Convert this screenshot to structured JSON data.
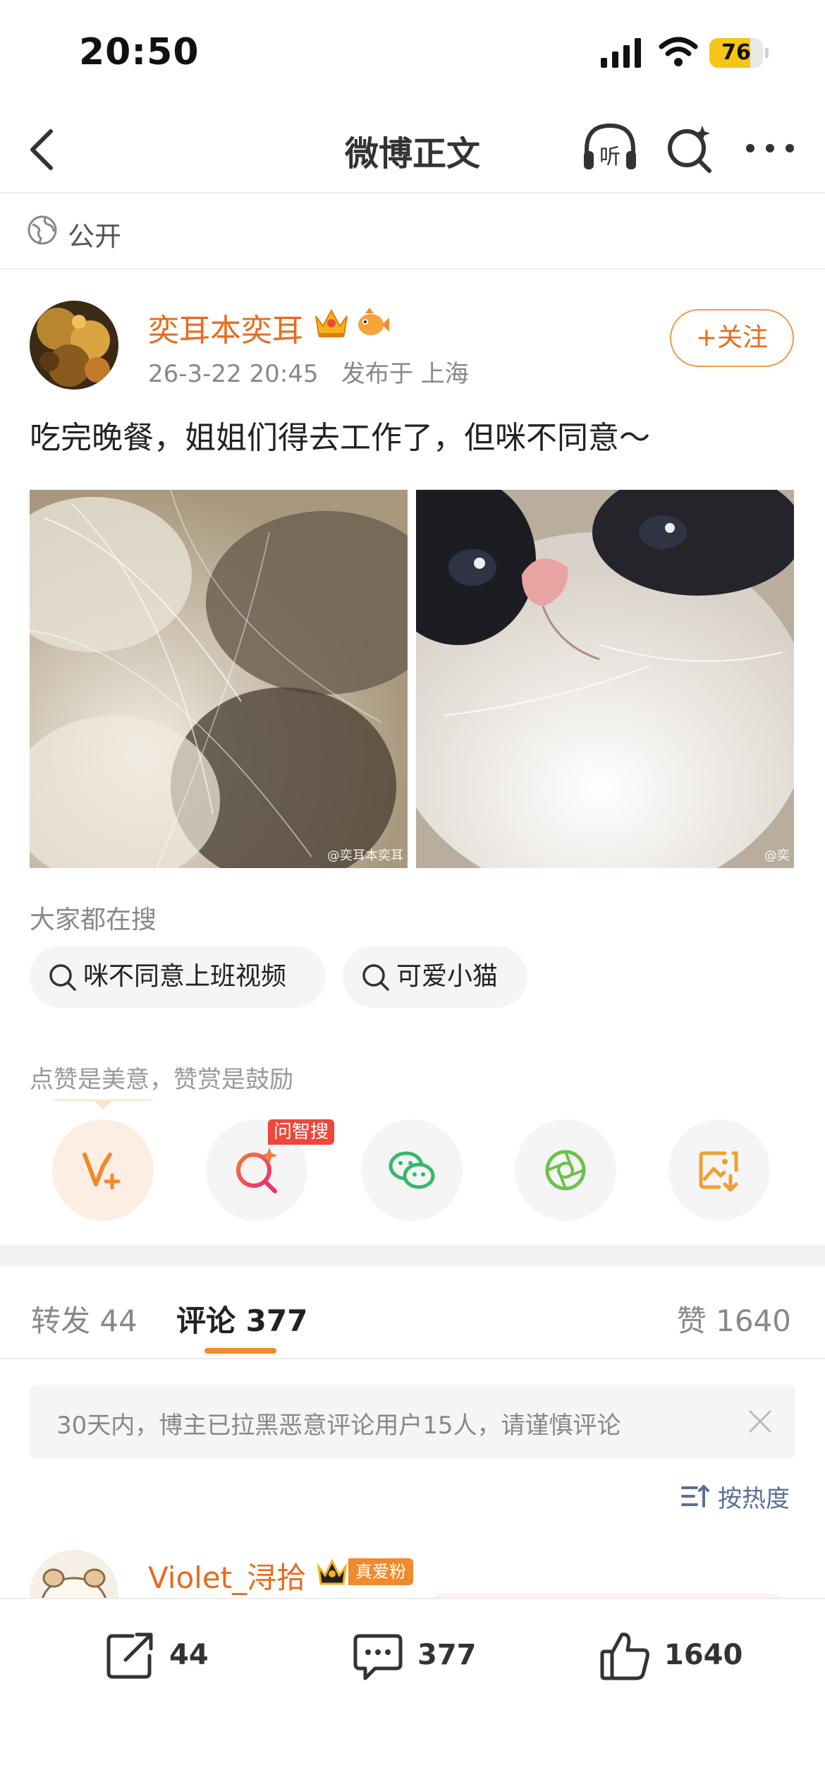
{
  "status_bar": {
    "time": "20:50",
    "battery": "76",
    "battery_level": 0.76
  },
  "nav": {
    "title": "微博正文",
    "listen_label": "听"
  },
  "visibility": "公开",
  "post": {
    "author": "奕耳本奕耳",
    "time": "26-3-22 20:45",
    "location": "发布于 上海",
    "follow_label": "+关注",
    "text": "吃完晚餐，姐姐们得去工作了，但咪不同意～",
    "watermark_1": "@奕耳本奕耳",
    "watermark_2": "@奕"
  },
  "trending": {
    "title": "大家都在搜",
    "chips": [
      "咪不同意上班视频",
      "可爱小猫"
    ]
  },
  "support": {
    "text": "点赞是美意，赞赏是鼓励",
    "ai_badge": "问智搜",
    "buttons": [
      "reward-icon",
      "ai-search-icon",
      "wechat-icon",
      "moments-icon",
      "save-image-icon"
    ]
  },
  "tabs": {
    "repost": "转发 44",
    "comments": "评论 377",
    "likes": "赞 1640"
  },
  "notice": "30天内，博主已拉黑恶意评论用户15人，请谨慎评论",
  "sort_label": "按热度",
  "comment_preview": {
    "user": "Violet_浔拾",
    "badge": "真爱粉"
  },
  "actions": {
    "repost_count": "44",
    "comment_count": "377",
    "like_count": "1640"
  },
  "colors": {
    "accent": "#e86b1c",
    "indicator": "#f08a2a",
    "link": "#5b6f97"
  }
}
